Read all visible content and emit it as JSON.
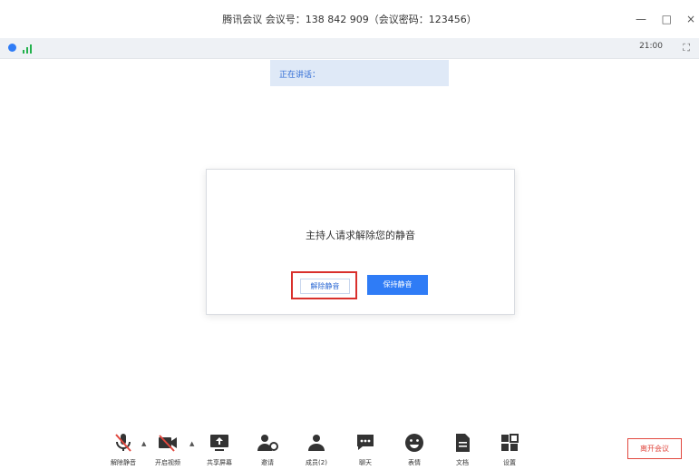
{
  "window": {
    "title": "腾讯会议 会议号：138 842 909（会议密码：123456）",
    "minimize": "—",
    "maximize": "□",
    "close": "×"
  },
  "status": {
    "time": "21:00",
    "fullscreen_icon": "⛶"
  },
  "banner": {
    "text": "正在讲话："
  },
  "dialog": {
    "message": "主持人请求解除您的静音",
    "unmute_button": "解除静音",
    "keep_mute_button": "保持静音"
  },
  "toolbar": {
    "items": [
      {
        "label": "解除静音",
        "icon": "mic-muted-icon"
      },
      {
        "label": "开启视频",
        "icon": "camera-off-icon"
      },
      {
        "label": "共享屏幕",
        "icon": "screen-share-icon"
      },
      {
        "label": "邀请",
        "icon": "invite-icon"
      },
      {
        "label": "成员(2)",
        "icon": "members-icon"
      },
      {
        "label": "聊天",
        "icon": "chat-icon"
      },
      {
        "label": "表情",
        "icon": "emoji-icon"
      },
      {
        "label": "文档",
        "icon": "document-icon"
      },
      {
        "label": "设置",
        "icon": "settings-icon"
      }
    ],
    "leave": "离开会议"
  },
  "colors": {
    "accent": "#2f7cf6",
    "danger": "#e1483f",
    "signal": "#23b14d"
  }
}
